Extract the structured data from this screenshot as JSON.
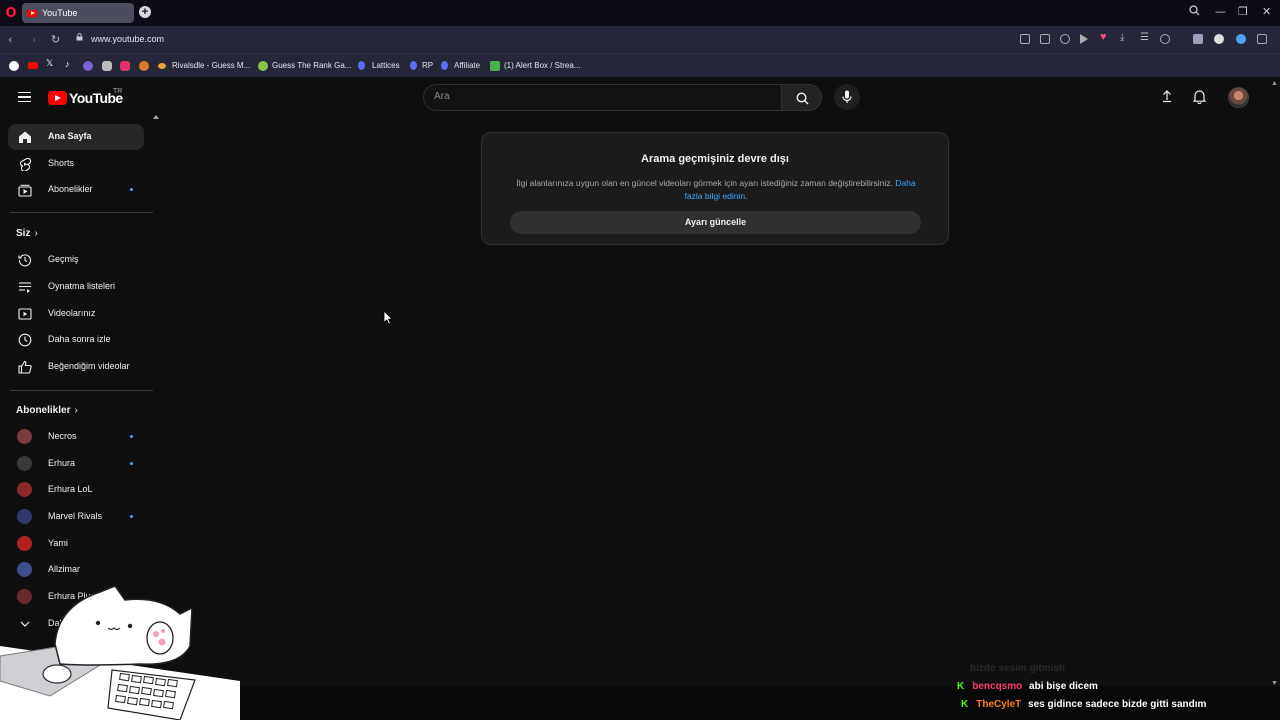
{
  "browser": {
    "tab_title": "YouTube",
    "url": "www.youtube.com",
    "bookmarks": [
      {
        "label": "Rivalsdle - Guess M...",
        "icon_color": "#e6a23c"
      },
      {
        "label": "Guess The Rank Ga...",
        "icon_color": "#8bc34a"
      },
      {
        "label": "Lattices",
        "icon_color": "#5b6cff"
      },
      {
        "label": "RP",
        "icon_color": "#5b6cff"
      },
      {
        "label": "Affiliate",
        "icon_color": "#5b6cff"
      },
      {
        "label": "(1) Alert Box / Strea...",
        "icon_color": "#4caf50"
      }
    ],
    "bookmark_icons": [
      "google-icon",
      "youtube-icon",
      "x-icon",
      "tiktok-icon",
      "badge-icon",
      "instagram-icon",
      "wavy-icon",
      "rss-icon"
    ]
  },
  "youtube": {
    "logo_text": "YouTube",
    "country_code": "TR",
    "search_placeholder": "Ara"
  },
  "sidebar": {
    "main": [
      {
        "label": "Ana Sayfa",
        "icon": "home-icon",
        "active": true,
        "dot": false
      },
      {
        "label": "Shorts",
        "icon": "shorts-icon",
        "active": false,
        "dot": false
      },
      {
        "label": "Abonelikler",
        "icon": "subscriptions-icon",
        "active": false,
        "dot": true
      }
    ],
    "you_header": "Siz",
    "you": [
      {
        "label": "Geçmiş",
        "icon": "history-icon"
      },
      {
        "label": "Oynatma listeleri",
        "icon": "playlist-icon"
      },
      {
        "label": "Videolarınız",
        "icon": "your-videos-icon"
      },
      {
        "label": "Daha sonra izle",
        "icon": "clock-icon"
      },
      {
        "label": "Beğendiğim videolar",
        "icon": "thumbs-up-icon"
      }
    ],
    "subs_header": "Abonelikler",
    "subs": [
      {
        "label": "Necros",
        "dot": true,
        "color": "#7a3b3b"
      },
      {
        "label": "Erhura",
        "dot": true,
        "color": "#3a3a3a"
      },
      {
        "label": "Erhura LoL",
        "dot": false,
        "color": "#8a2a2a"
      },
      {
        "label": "Marvel Rivals",
        "dot": true,
        "color": "#2d3a6b"
      },
      {
        "label": "Yami",
        "dot": false,
        "color": "#b02020"
      },
      {
        "label": "Allzimar",
        "dot": false,
        "color": "#3b4f8a"
      },
      {
        "label": "Erhura Plus",
        "dot": false,
        "color": "#6b2a2a"
      }
    ],
    "more_label": "Dah"
  },
  "card": {
    "title": "Arama geçmişiniz devre dışı",
    "description": "İlgi alanlarınıza uygun olan en güncel videoları görmek için ayarı istediğiniz zaman değiştirebilirsiniz.",
    "link_text": "Daha fazla bilgi edinin",
    "button_label": "Ayarı güncelle"
  },
  "chat": [
    {
      "user": "bencqsmo",
      "user_color": "#ff3b6b",
      "message": "abi bişe dicem"
    },
    {
      "user": "TheCyleT",
      "user_color": "#ff7a1a",
      "message": "ses gidince sadece bizde gitti sandım"
    }
  ],
  "chat_ghost": "bizde sesim gitmişti"
}
